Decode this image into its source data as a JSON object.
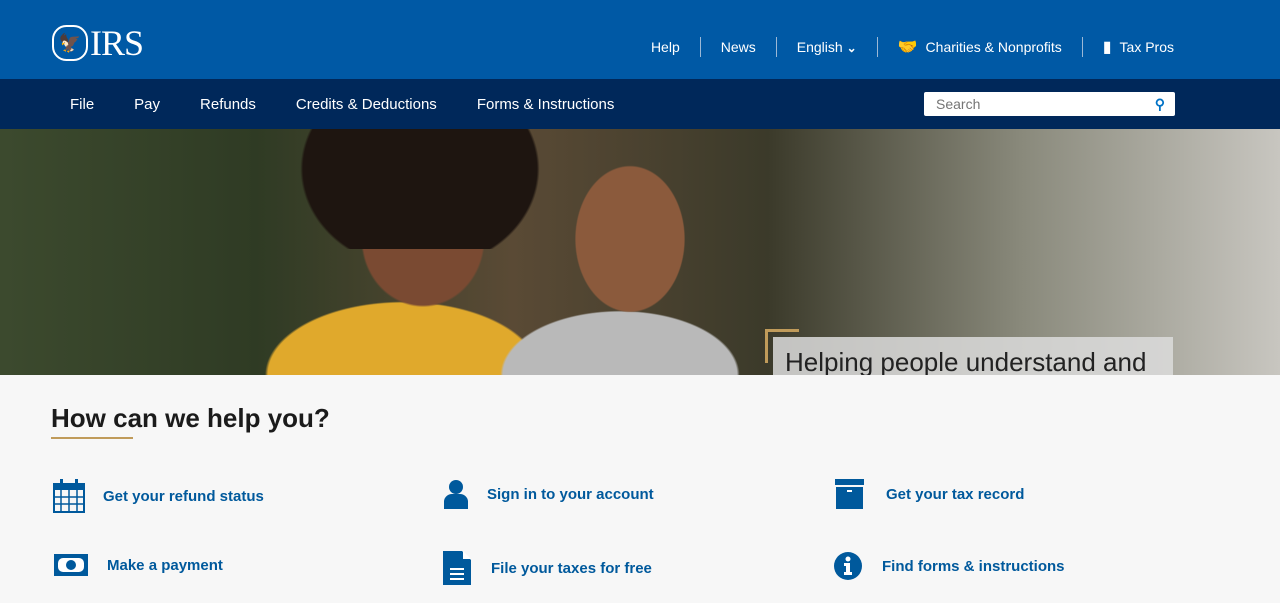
{
  "header": {
    "logo_text": "IRS",
    "util": [
      {
        "label": "Help"
      },
      {
        "label": "News"
      },
      {
        "label": "English",
        "icon": "chevron-down-icon"
      },
      {
        "label": "Charities & Nonprofits",
        "icon": "handshake-icon"
      },
      {
        "label": "Tax Pros",
        "icon": "book-icon"
      }
    ]
  },
  "nav": {
    "items": [
      "File",
      "Pay",
      "Refunds",
      "Credits & Deductions",
      "Forms & Instructions"
    ],
    "search_placeholder": "Search"
  },
  "hero": {
    "caption": "Helping people understand and meet their tax responsibilities"
  },
  "help": {
    "title": "How can we help you?",
    "links": [
      {
        "label": "Get your refund status",
        "icon": "calendar-icon"
      },
      {
        "label": "Sign in to your account",
        "icon": "user-icon"
      },
      {
        "label": "Get your tax record",
        "icon": "archive-box-icon"
      },
      {
        "label": "Make a payment",
        "icon": "money-icon"
      },
      {
        "label": "File your taxes for free",
        "icon": "document-icon"
      },
      {
        "label": "Find forms & instructions",
        "icon": "info-icon"
      }
    ]
  },
  "colors": {
    "header": "#0059a5",
    "nav": "#00285a",
    "link": "#00599c",
    "accent": "#c09b5a"
  }
}
